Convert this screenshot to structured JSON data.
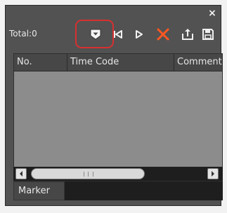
{
  "panel": {
    "total_label": "Total:0",
    "close_glyph": "×"
  },
  "toolbar": {
    "icons": [
      "add-marker-icon",
      "previous-marker-icon",
      "next-marker-icon",
      "delete-marker-icon",
      "export-icon",
      "save-icon"
    ],
    "highlight_color": "#d83030",
    "delete_color": "#ff5722"
  },
  "table": {
    "columns": [
      "No.",
      "Time Code",
      "Comment"
    ]
  },
  "tabs": {
    "active": "Marker"
  },
  "colors": {
    "panel_bg": "#525252",
    "grid_bg": "#8c8c8c",
    "header_bg": "#474747"
  }
}
